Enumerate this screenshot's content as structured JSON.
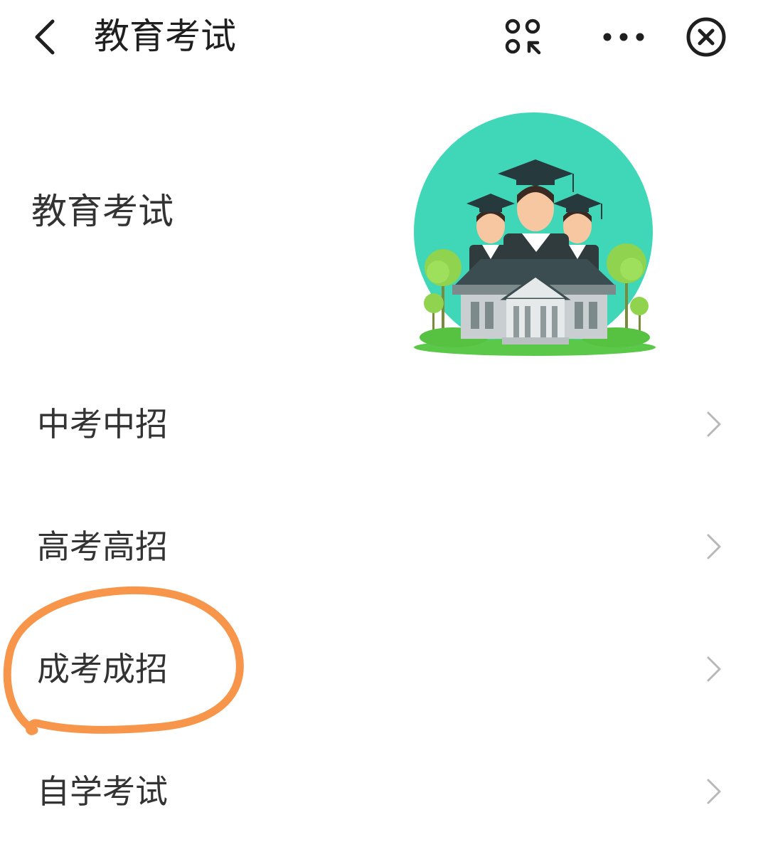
{
  "navbar": {
    "back_icon": "chevron-left-icon",
    "title": "教育考试",
    "scan_icon": "mini-program-scan-icon",
    "more_icon": "ellipsis-icon",
    "close_icon": "close-circle-icon"
  },
  "header": {
    "title": "教育考试",
    "illustration": "graduates-university-illustration"
  },
  "menu": {
    "items": [
      {
        "label": "中考中招",
        "icon": "chevron-right-icon"
      },
      {
        "label": "高考高招",
        "icon": "chevron-right-icon"
      },
      {
        "label": "成考成招",
        "icon": "chevron-right-icon"
      },
      {
        "label": "自学考试",
        "icon": "chevron-right-icon"
      }
    ]
  },
  "colors": {
    "circle_bg": "#3fd7b8",
    "highlight_stroke": "#f7964a",
    "chevron": "#b8b8b8",
    "text": "#333333"
  }
}
